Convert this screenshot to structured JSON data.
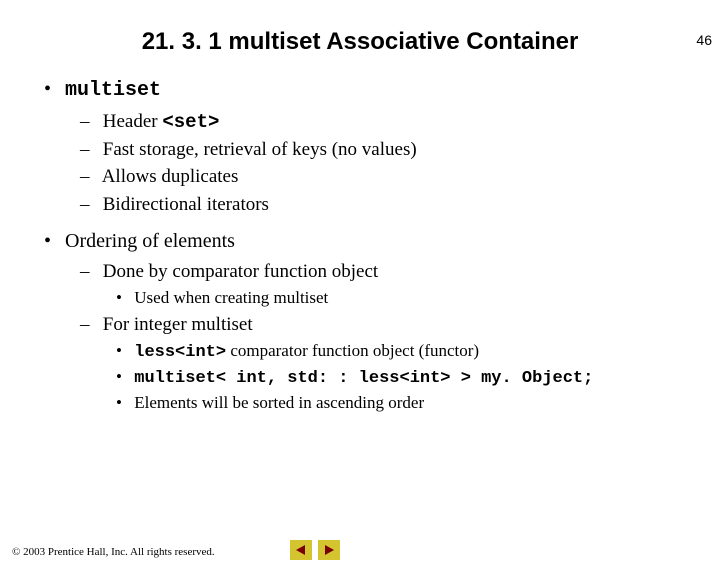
{
  "page_number": "46",
  "title": "21. 3. 1 multiset Associative Container",
  "bullets": {
    "a": {
      "text": "multiset"
    },
    "a1": {
      "prefix": "Header ",
      "code": "<set>"
    },
    "a2": {
      "text": "Fast storage, retrieval of keys (no values)"
    },
    "a3": {
      "text": "Allows duplicates"
    },
    "a4": {
      "text": "Bidirectional iterators"
    },
    "b": {
      "text": "Ordering of elements"
    },
    "b1": {
      "text": "Done by comparator function object"
    },
    "b1a": {
      "text": "Used when creating multiset"
    },
    "b2": {
      "text": "For integer multiset"
    },
    "b2a": {
      "code": "less<int>",
      "suffix": " comparator function object (functor)"
    },
    "b2b": {
      "code": "multiset< int, std: : less<int> > my. Object;"
    },
    "b2c": {
      "text": "Elements will be sorted in ascending order"
    }
  },
  "footer": "© 2003 Prentice Hall, Inc. All rights reserved.",
  "nav": {
    "prev": "previous-slide",
    "next": "next-slide"
  }
}
